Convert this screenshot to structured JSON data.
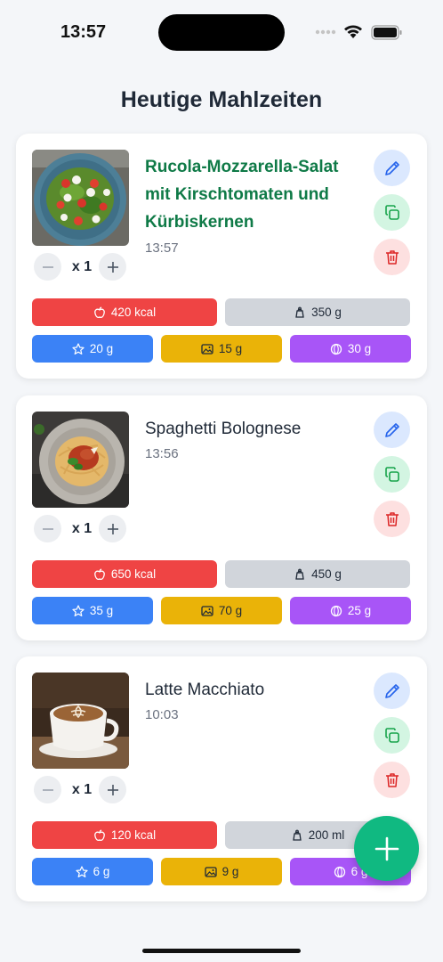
{
  "status": {
    "time": "13:57"
  },
  "page": {
    "title": "Heutige Mahlzeiten"
  },
  "meals": [
    {
      "name": "Rucola-Mozzarella-Salat mit Kirschtomaten und Kürbiskernen",
      "time": "13:57",
      "quantity": "x 1",
      "kcal": "420 kcal",
      "weight": "350 g",
      "protein": "20 g",
      "carbs": "15 g",
      "fat": "30 g",
      "image": "salad-photo"
    },
    {
      "name": "Spaghetti Bolognese",
      "time": "13:56",
      "quantity": "x 1",
      "kcal": "650 kcal",
      "weight": "450 g",
      "protein": "35 g",
      "carbs": "70 g",
      "fat": "25 g",
      "image": "spaghetti-photo"
    },
    {
      "name": "Latte Macchiato",
      "time": "10:03",
      "quantity": "x 1",
      "kcal": "120 kcal",
      "weight": "200 ml",
      "protein": "6 g",
      "carbs": "9 g",
      "fat": "6 g",
      "image": "latte-photo"
    }
  ],
  "colors": {
    "kcal": "#ef4444",
    "weight": "#d1d5db",
    "protein": "#3b82f6",
    "carbs": "#eab308",
    "fat": "#a855f7",
    "fab": "#10b981",
    "highlight_title": "#0f7a47"
  },
  "icons": {
    "edit": "pencil-icon",
    "copy": "copy-icon",
    "delete": "trash-icon",
    "kcal": "apple-icon",
    "weight": "scale-icon",
    "protein": "star-icon",
    "carbs": "image-icon",
    "fat": "circle-icon",
    "fab": "plus-icon"
  }
}
